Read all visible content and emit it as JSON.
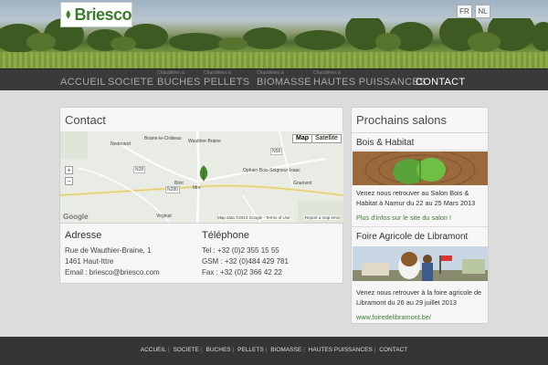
{
  "header": {
    "logo_text": "Briesco",
    "lang_fr": "FR",
    "lang_nl": "NL"
  },
  "nav": {
    "items": [
      {
        "label": "ACCUEIL",
        "sup": ""
      },
      {
        "label": "SOCIETE",
        "sup": ""
      },
      {
        "label": "BUCHES",
        "sup": "Chaudières à"
      },
      {
        "label": "PELLETS",
        "sup": "Chaudières à"
      },
      {
        "label": "BIOMASSE",
        "sup": "Chaudières à"
      },
      {
        "label": "HAUTES PUISSANCES",
        "sup": "Chaudières à"
      },
      {
        "label": "CONTACT",
        "sup": ""
      }
    ]
  },
  "contact": {
    "title": "Contact",
    "map": {
      "map_label": "Map",
      "satellite_label": "Satellite",
      "zoom_in": "+",
      "zoom_out": "−",
      "copyright": "Map data ©2013 Google - Terms of Use",
      "report": "Report a map error",
      "google": "Google",
      "places": [
        "Nederand",
        "Braine-le-Château",
        "Wauthier-Braine",
        "Ophain-Bois-Seigneur-Isaac",
        "Bilot",
        "Ittre",
        "Goumont",
        "Virginal"
      ],
      "roads": [
        "N28",
        "N280",
        "N58",
        "N233",
        "N252",
        "N251",
        "N253"
      ]
    },
    "address": {
      "title": "Adresse",
      "lines": [
        "Rue de Wauthier-Braine, 1",
        "1461 Haut-Ittre",
        "Email : briesco@briesco.com"
      ]
    },
    "phone": {
      "title": "Téléphone",
      "lines": [
        "Tel : +32 (0)2 355 15 55",
        "GSM : +32 (0)484 429 781",
        "Fax : +32 (0)2 366 42 22"
      ]
    }
  },
  "salons": {
    "title": "Prochains salons",
    "events": [
      {
        "name": "Bois & Habitat",
        "text": "Venez nous retrouver au Salon Bois & Habitat à Namur du 22 au 25 Mars 2013",
        "link": "Plus d'infos sur le site du salon !"
      },
      {
        "name": "Foire Agricole de Libramont",
        "text": "Venez nous retrouver à la foire agricole de Libramont du 26 au 29 juillet 2013",
        "link": "www.foiredelibramont.be/"
      }
    ]
  },
  "footer": {
    "links": [
      "ACCUEIL",
      "SOCIETE",
      "BUCHES",
      "PELLETS",
      "BIOMASSE",
      "HAUTES PUISSANCES",
      "CONTACT"
    ]
  },
  "colors": {
    "brand_green": "#3c7a2c",
    "nav_bg": "#3a3a3a",
    "footer_bg": "#353535",
    "link_green": "#3f7a32"
  }
}
